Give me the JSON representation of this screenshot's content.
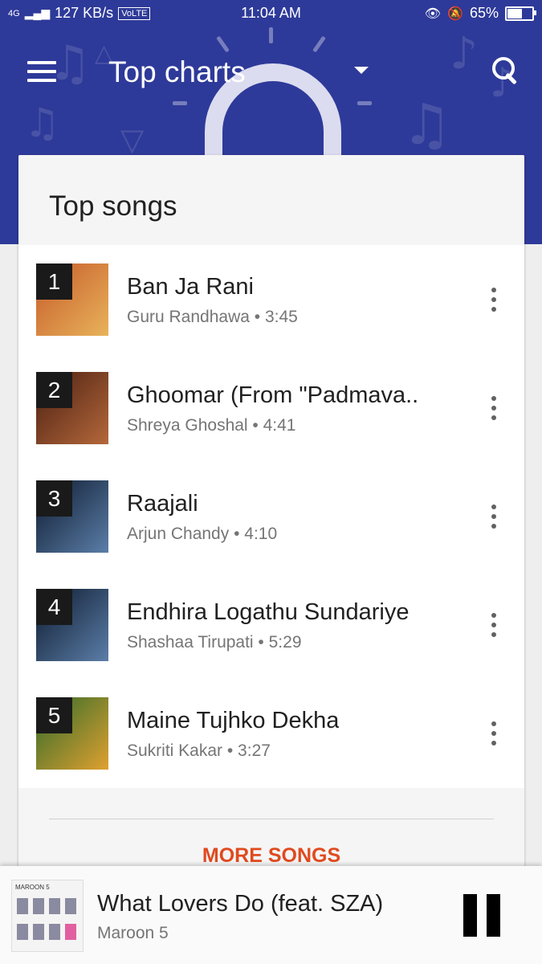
{
  "status_bar": {
    "network": "4G",
    "speed": "127 KB/s",
    "volte": "VoLTE",
    "time": "11:04 AM",
    "battery": "65%",
    "battery_level": 0.65
  },
  "header": {
    "title": "Top charts",
    "menu_icon": "menu-icon",
    "search_icon": "search-icon",
    "dropdown_icon": "dropdown-caret-icon"
  },
  "card": {
    "title": "Top songs",
    "songs": [
      {
        "rank": "1",
        "title": "Ban Ja Rani",
        "subtitle": "Guru Randhawa • 3:45",
        "art_colors": [
          "#c65a2a",
          "#e8b35a"
        ]
      },
      {
        "rank": "2",
        "title": "Ghoomar (From \"Padmava..",
        "subtitle": "Shreya Ghoshal • 4:41",
        "art_colors": [
          "#4a1f12",
          "#b4683a"
        ]
      },
      {
        "rank": "3",
        "title": "Raajali",
        "subtitle": "Arjun Chandy • 4:10",
        "art_colors": [
          "#0d1a2e",
          "#5b7ea8"
        ]
      },
      {
        "rank": "4",
        "title": "Endhira Logathu Sundariye",
        "subtitle": "Shashaa Tirupati • 5:29",
        "art_colors": [
          "#0d1a2e",
          "#5b7ea8"
        ]
      },
      {
        "rank": "5",
        "title": "Maine Tujhko Dekha",
        "subtitle": "Sukriti Kakar • 3:27",
        "art_colors": [
          "#2d6b2a",
          "#e0a030"
        ]
      }
    ],
    "more_label": "MORE SONGS"
  },
  "now_playing": {
    "title": "What Lovers Do (feat. SZA)",
    "artist": "Maroon 5",
    "album_band": "MAROON 5",
    "pause_icon": "pause-icon"
  },
  "colors": {
    "header_bg": "#2e3a99",
    "accent": "#e04a1f"
  }
}
